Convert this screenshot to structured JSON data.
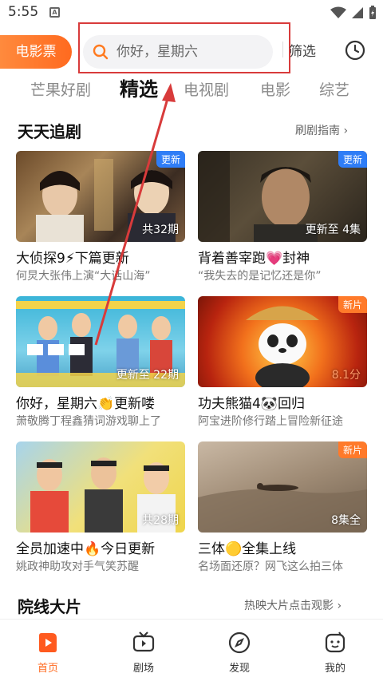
{
  "status_bar": {
    "time": "5:55",
    "notification_letter": "A"
  },
  "header": {
    "ticket_button": "电影票",
    "search_placeholder": "你好，星期六",
    "filter_button": "筛选"
  },
  "tabs": [
    {
      "label": "芒果好剧"
    },
    {
      "label": "精选",
      "active": true
    },
    {
      "label": "电视剧"
    },
    {
      "label": "电影"
    },
    {
      "label": "综艺"
    }
  ],
  "section_daily": {
    "title": "天天追剧",
    "link": "刷剧指南"
  },
  "cards": [
    {
      "title": "大侦探9⚡下篇更新",
      "subtitle": "何炅大张伟上演“大话山海”",
      "episode": "共32期",
      "badge": "更新",
      "badge_color": "#2f7df6"
    },
    {
      "title": "背着善宰跑💗封神",
      "subtitle": "“我失去的是记忆还是你”",
      "episode": "更新至 4集",
      "badge": "更新",
      "badge_color": "#2f7df6"
    },
    {
      "title": "你好，星期六👏更新喽",
      "subtitle": "萧敬腾丁程鑫猜词游戏聊上了",
      "episode": "更新至 22期",
      "badge": "",
      "badge_color": ""
    },
    {
      "title": "功夫熊猫4🐼回归",
      "subtitle": "阿宝进阶修行踏上冒险新征途",
      "episode": "8.1分",
      "badge": "新片",
      "badge_color": "#ff7a2a"
    },
    {
      "title": "全员加速中🔥今日更新",
      "subtitle": "姚政神助攻对手气笑苏醒",
      "episode": "共28期",
      "badge": "",
      "badge_color": ""
    },
    {
      "title": "三体🟡全集上线",
      "subtitle": "名场面还原？网飞这么拍三体",
      "episode": "8集全",
      "badge": "新片",
      "badge_color": "#ff7a2a"
    }
  ],
  "section_cinema": {
    "title": "院线大片",
    "link": "热映大片点击观影"
  },
  "bottom_nav": [
    {
      "label": "首页",
      "icon": "home-play-icon",
      "active": true
    },
    {
      "label": "剧场",
      "icon": "tv-icon"
    },
    {
      "label": "发现",
      "icon": "compass-icon"
    },
    {
      "label": "我的",
      "icon": "profile-face-icon"
    }
  ],
  "colors": {
    "accent": "#ff6a1f",
    "annotation_red": "#d83b3b",
    "badge_blue": "#2f7df6",
    "badge_orange": "#ff7a2a"
  }
}
